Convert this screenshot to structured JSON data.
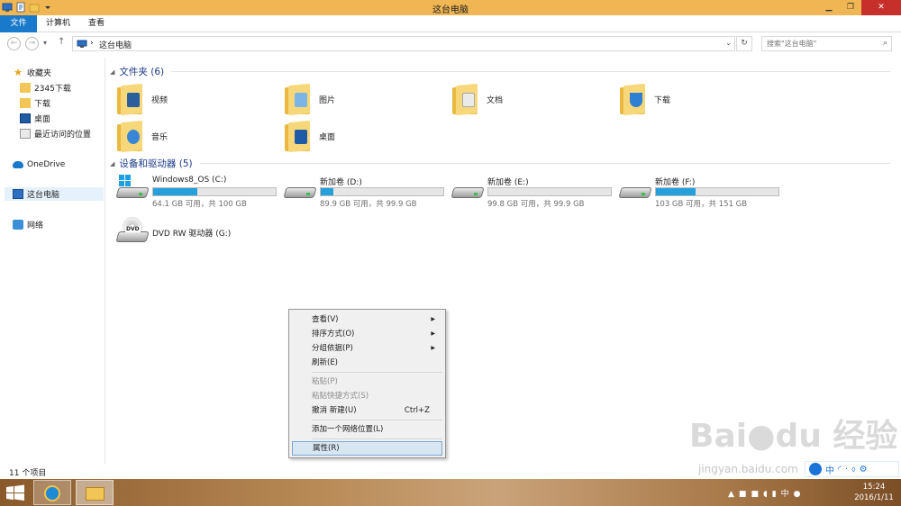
{
  "window": {
    "title": "这台电脑",
    "controls": [
      "minimize-icon",
      "maximize-icon",
      "close-icon"
    ]
  },
  "ribbon": {
    "tabs": [
      "文件",
      "计算机",
      "查看"
    ]
  },
  "address": {
    "path": "这台电脑",
    "search_placeholder": "搜索\"这台电脑\""
  },
  "nav": {
    "favorites": "收藏夹",
    "favorites_items": [
      "2345下载",
      "下载",
      "桌面",
      "最近访问的位置"
    ],
    "onedrive": "OneDrive",
    "this_pc": "这台电脑",
    "network": "网络"
  },
  "folders_group": {
    "title": "文件夹 (6)",
    "items": [
      "视频",
      "图片",
      "文档",
      "下载",
      "音乐",
      "桌面"
    ]
  },
  "drives_group": {
    "title": "设备和驱动器 (5)",
    "drives": [
      {
        "name": "Windows8_OS (C:)",
        "info": "64.1 GB 可用，共 100 GB",
        "used_fraction": 0.36
      },
      {
        "name": "新加卷 (D:)",
        "info": "89.9 GB 可用，共 99.9 GB",
        "used_fraction": 0.1
      },
      {
        "name": "新加卷 (E:)",
        "info": "99.8 GB 可用，共 99.9 GB",
        "used_fraction": 0.0
      },
      {
        "name": "新加卷 (F:)",
        "info": "103 GB 可用，共 151 GB",
        "used_fraction": 0.32
      }
    ],
    "dvd": {
      "name": "DVD RW 驱动器 (G:)",
      "label": "DVD"
    }
  },
  "context_menu": {
    "items": [
      {
        "label": "查看(V)",
        "submenu": true
      },
      {
        "label": "排序方式(O)",
        "submenu": true
      },
      {
        "label": "分组依据(P)",
        "submenu": true
      },
      {
        "label": "刷新(E)"
      },
      {
        "label": "粘贴(P)",
        "disabled": true
      },
      {
        "label": "粘贴快捷方式(S)",
        "disabled": true
      },
      {
        "label": "撤消 新建(U)",
        "shortcut": "Ctrl+Z"
      },
      {
        "label": "添加一个网络位置(L)"
      },
      {
        "label": "属性(R)",
        "highlighted": true
      }
    ]
  },
  "status": {
    "item_count": "11 个项目"
  },
  "ime": {
    "lang": "中"
  },
  "taskbar": {
    "tray_lang": "中",
    "time": "15:24",
    "date": "2016/1/11"
  },
  "watermark": {
    "logo_text": "Baidu经验",
    "url": "jingyan.baidu.com"
  },
  "colors": {
    "title_bar": "#f0b654",
    "file_tab": "#1979ca",
    "group_header": "#1c3a88",
    "drive_fill": "#26a0da"
  }
}
